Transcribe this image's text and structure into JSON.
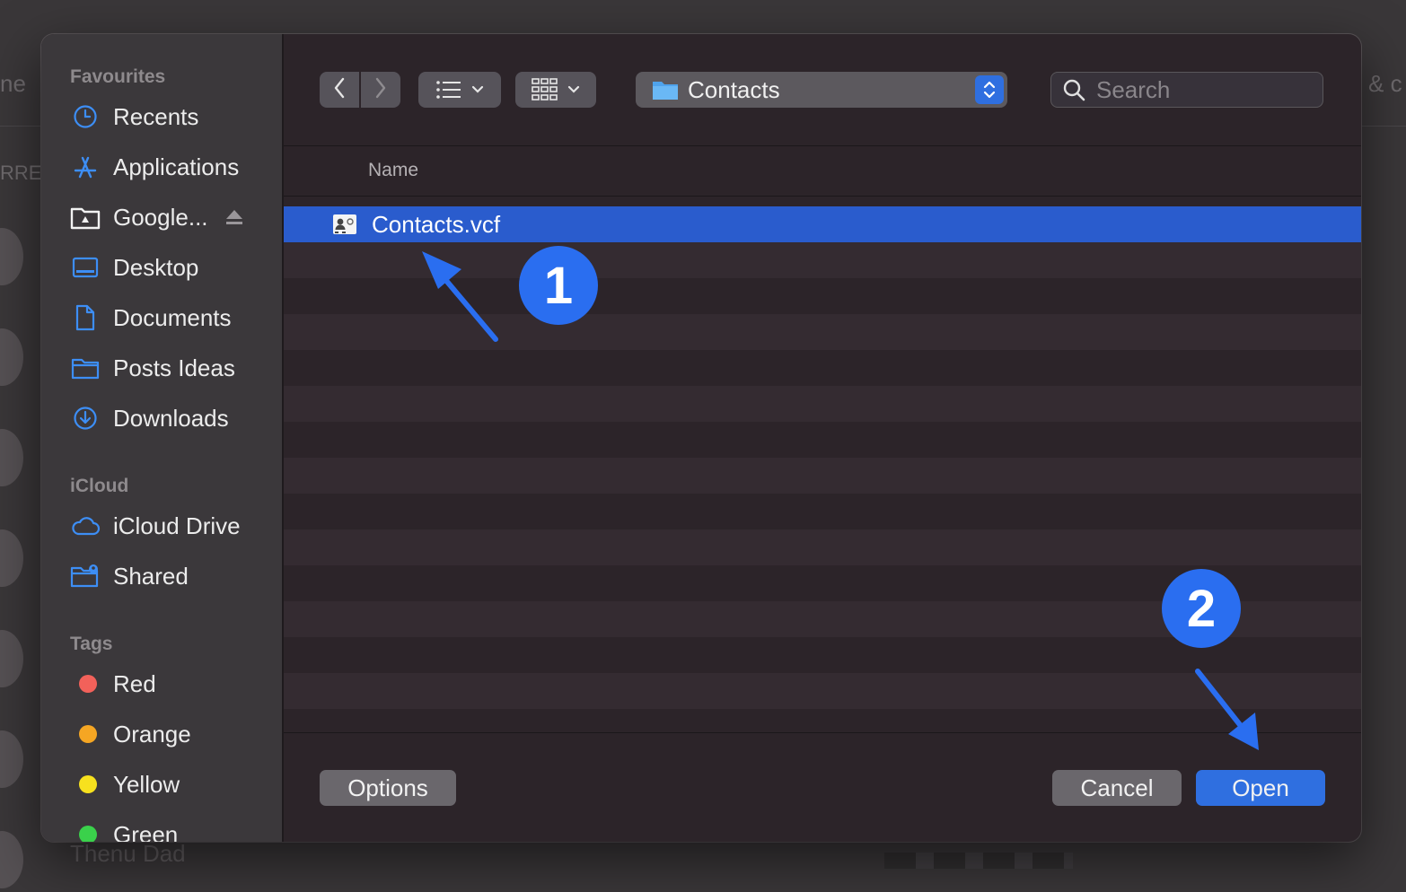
{
  "background_app": {
    "frag_left_top": "ne",
    "frag_left_mid": "RREI",
    "frag_right_top": "& c",
    "bottom_name": "Thenu Dad"
  },
  "sidebar": {
    "favourites_heading": "Favourites",
    "favourites": [
      {
        "label": "Recents",
        "icon": "clock-icon"
      },
      {
        "label": "Applications",
        "icon": "applications-icon"
      },
      {
        "label": "Google...",
        "icon": "google-drive-folder-icon"
      },
      {
        "label": "Desktop",
        "icon": "desktop-icon"
      },
      {
        "label": "Documents",
        "icon": "document-icon"
      },
      {
        "label": "Posts Ideas",
        "icon": "folder-icon"
      },
      {
        "label": "Downloads",
        "icon": "downloads-icon"
      }
    ],
    "icloud_heading": "iCloud",
    "icloud": [
      {
        "label": "iCloud Drive",
        "icon": "cloud-icon"
      },
      {
        "label": "Shared",
        "icon": "shared-folder-icon"
      }
    ],
    "tags_heading": "Tags",
    "tags": [
      {
        "label": "Red",
        "color": "#f2615a"
      },
      {
        "label": "Orange",
        "color": "#f5a623"
      },
      {
        "label": "Yellow",
        "color": "#f7e11e"
      },
      {
        "label": "Green",
        "color": "#3ad14b"
      }
    ]
  },
  "toolbar": {
    "location": "Contacts",
    "search_placeholder": "Search"
  },
  "file_list": {
    "column_name": "Name",
    "files": [
      {
        "name": "Contacts.vcf",
        "selected": true
      }
    ]
  },
  "buttons": {
    "options": "Options",
    "cancel": "Cancel",
    "open": "Open"
  },
  "annotations": {
    "step1": "1",
    "step2": "2",
    "color": "#2a6ef0"
  },
  "colors": {
    "accent": "#2f6fe0",
    "selection": "#2a5ccd"
  }
}
